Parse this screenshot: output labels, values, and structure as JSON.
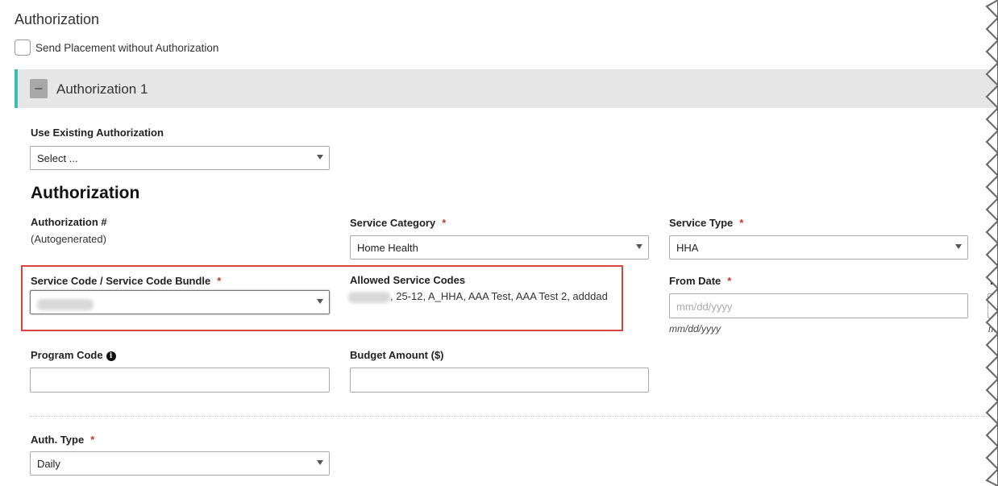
{
  "section_title": "Authorization",
  "send_without_auth": {
    "label": "Send Placement without Authorization",
    "checked": false
  },
  "auth_panel": {
    "collapse_symbol": "–",
    "title": "Authorization 1"
  },
  "use_existing": {
    "label": "Use Existing Authorization",
    "value": "Select ..."
  },
  "heading": "Authorization",
  "auth_number": {
    "label": "Authorization #",
    "value": "(Autogenerated)"
  },
  "service_category": {
    "label": "Service Category",
    "required": "*",
    "value": "Home Health"
  },
  "service_type": {
    "label": "Service Type",
    "required": "*",
    "value": "HHA"
  },
  "service_code": {
    "label": "Service Code / Service Code Bundle",
    "required": "*"
  },
  "allowed_codes": {
    "label": "Allowed Service Codes",
    "value": ", 25-12, A_HHA, AAA Test, AAA Test 2, adddad"
  },
  "from_date": {
    "label": "From Date",
    "required": "*",
    "placeholder": "mm/dd/yyyy",
    "hint": "mm/dd/yyyy"
  },
  "to_date": {
    "label": "To",
    "hint": "m"
  },
  "program_code": {
    "label": "Program Code",
    "info_icon": "info-icon"
  },
  "budget_amount": {
    "label": "Budget Amount ($)"
  },
  "auth_type": {
    "label": "Auth. Type",
    "required": "*",
    "value": "Daily"
  },
  "colors": {
    "accent": "#3dbdb2",
    "required": "#c0392b",
    "highlight": "#d9443f"
  }
}
